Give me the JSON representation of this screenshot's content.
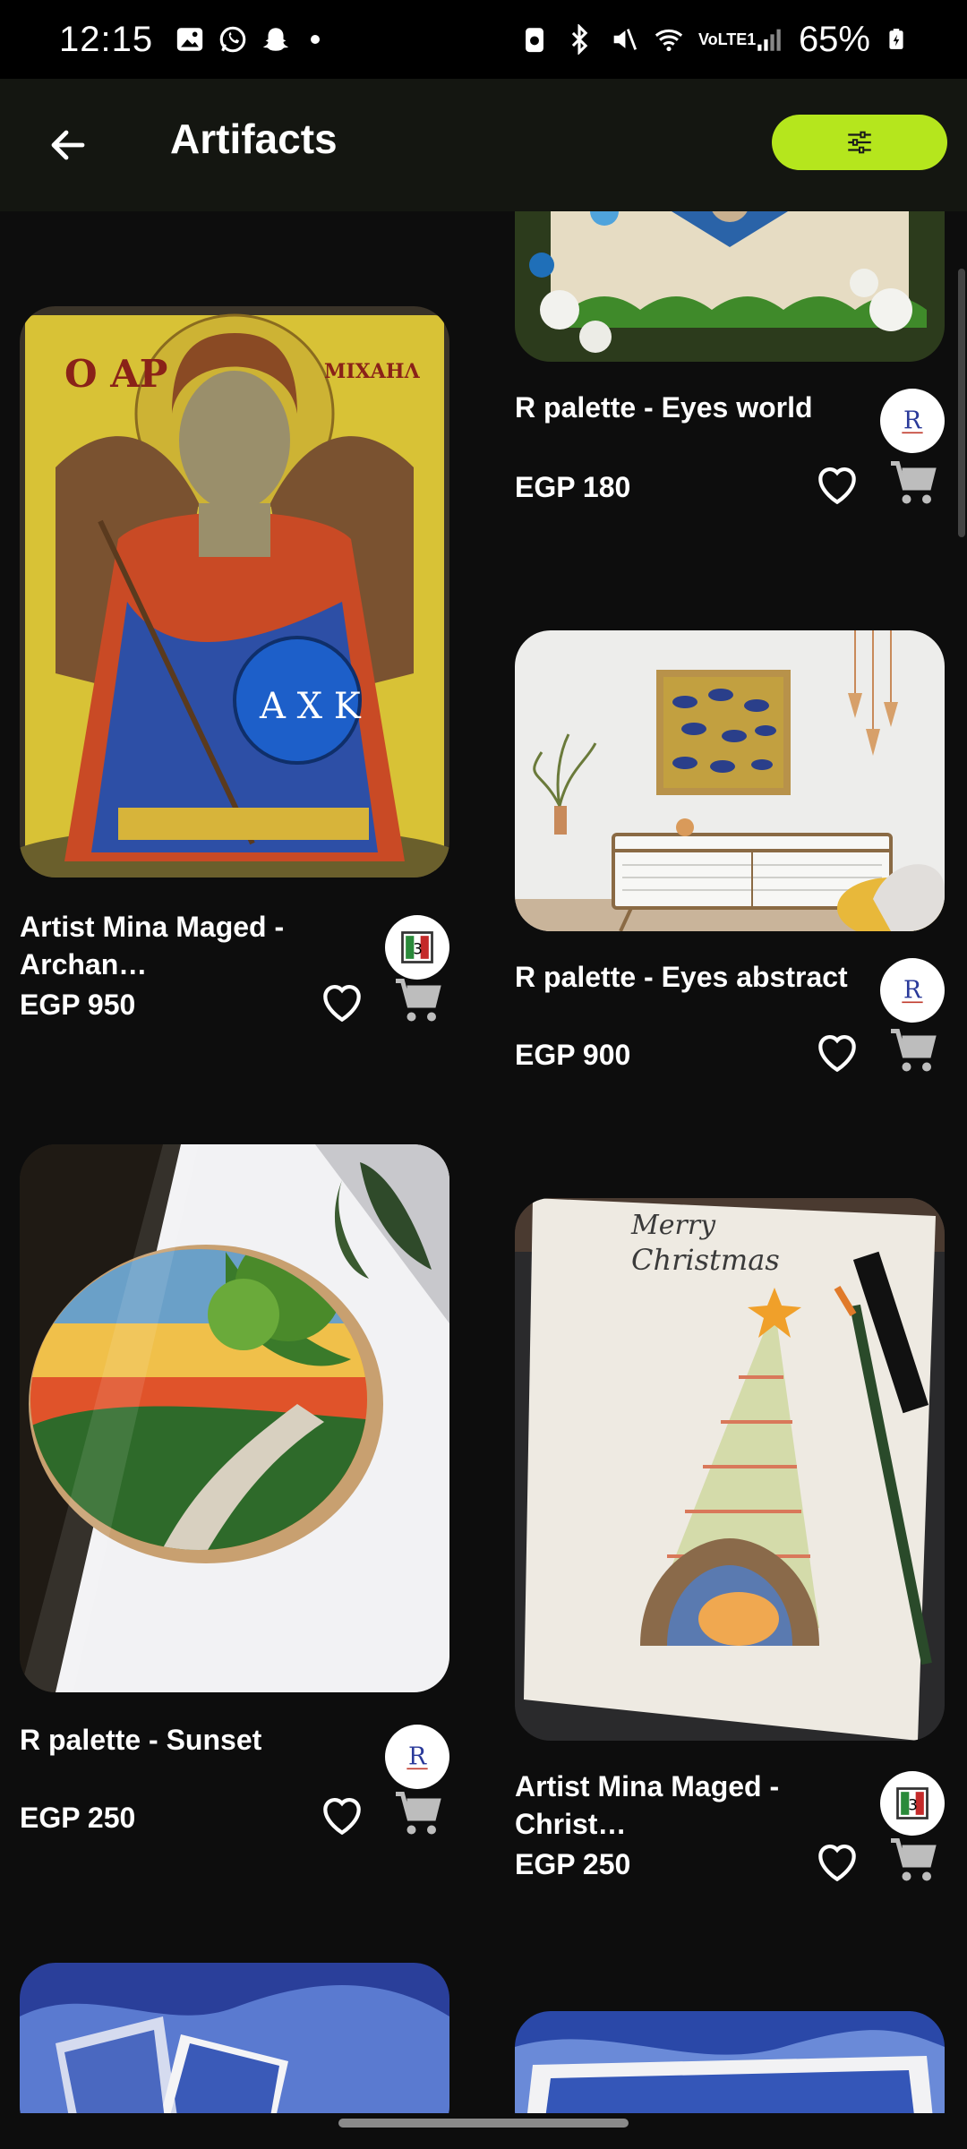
{
  "status_bar": {
    "time": "12:15",
    "battery": "65%",
    "network": "VoLTE1"
  },
  "app_bar": {
    "title": "Artifacts",
    "back_icon": "arrow-left-icon",
    "filter_icon": "sliders-icon",
    "accent": "#b5e61d"
  },
  "products": [
    {
      "title": "Artist Mina Maged  - Archan…",
      "price": "EGP 950",
      "store": "Artist Mina Maged"
    },
    {
      "title": "R palette - Eyes world",
      "price": "EGP 180",
      "store": "R palette"
    },
    {
      "title": "R palette - Eyes abstract",
      "price": "EGP 900",
      "store": "R palette"
    },
    {
      "title": "R palette - Sunset",
      "price": "EGP 250",
      "store": "R palette"
    },
    {
      "title": "Artist Mina Maged  - Christ…",
      "price": "EGP 250",
      "store": "Artist Mina Maged"
    }
  ],
  "thumbnail_text": {
    "icon_left": "Ο ΑΡ",
    "icon_right": "ΜΙΧΑΗΛ",
    "icon_shield": "Α Χ Κ",
    "card_merry": "Merry",
    "card_christmas": "Christmas"
  }
}
